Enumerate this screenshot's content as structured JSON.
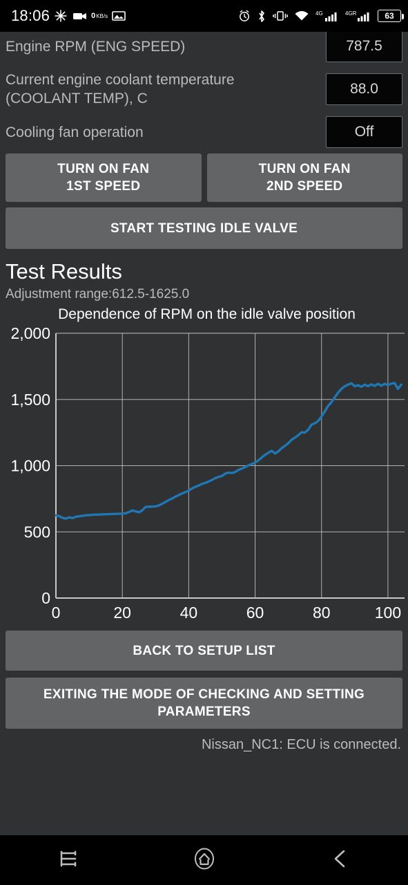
{
  "status_bar": {
    "clock": "18:06",
    "net_speed_value": "0",
    "net_speed_unit": "KB/s",
    "battery": "63",
    "network_1": "4G",
    "network_2": "4GR",
    "icons": [
      "burst-icon",
      "camera-icon",
      "image-icon",
      "alarm-icon",
      "bluetooth-icon",
      "vibrate-icon",
      "wifi-icon",
      "signal-icon",
      "signal-icon",
      "battery-icon"
    ]
  },
  "params": [
    {
      "label": "Engine RPM (ENG SPEED)",
      "value": "787.5"
    },
    {
      "label": "Current engine coolant temperature (COOLANT TEMP), C",
      "value": "88.0"
    },
    {
      "label": "Cooling fan operation",
      "value": "Off"
    }
  ],
  "buttons": {
    "fan1_line1": "TURN ON FAN",
    "fan1_line2": "1ST SPEED",
    "fan2_line1": "TURN ON FAN",
    "fan2_line2": "2ND SPEED",
    "start_test": "START TESTING IDLE VALVE",
    "back_to_setup": "BACK TO SETUP LIST",
    "exit_line1": "EXITING THE MODE OF CHECKING AND SETTING",
    "exit_line2": "PARAMETERS"
  },
  "results": {
    "heading": "Test Results",
    "adjustment_range": "Adjustment range:612.5-1625.0"
  },
  "status_line": "Nissan_NC1: ECU is connected.",
  "nav": {
    "recents": "recents-icon",
    "home": "home-icon",
    "back": "back-icon"
  },
  "colors": {
    "line": "#1f77b4",
    "grid": "#c8c8c8",
    "panel": "#303133",
    "button": "#636466",
    "text": "#b9bbbd"
  },
  "chart_data": {
    "type": "line",
    "title": "Dependence of RPM on the idle valve position",
    "xlabel": "",
    "ylabel": "",
    "xlim": [
      0,
      105
    ],
    "ylim": [
      0,
      2000
    ],
    "xticks": [
      0,
      20,
      40,
      60,
      80,
      100
    ],
    "yticks": [
      0,
      500,
      1000,
      1500,
      2000
    ],
    "ytick_labels": [
      "0",
      "500",
      "1,000",
      "1,500",
      "2,000"
    ],
    "xtick_labels": [
      "0",
      "20",
      "40",
      "60",
      "80",
      "100"
    ],
    "grid": true,
    "legend": "none",
    "series": [
      {
        "name": "RPM",
        "x": [
          0,
          1,
          2,
          3,
          4,
          5,
          6,
          7,
          8,
          9,
          10,
          11,
          12,
          13,
          14,
          15,
          16,
          17,
          18,
          19,
          20,
          21,
          22,
          23,
          24,
          25,
          26,
          27,
          28,
          29,
          30,
          31,
          32,
          33,
          34,
          35,
          36,
          37,
          38,
          39,
          40,
          41,
          42,
          43,
          44,
          45,
          46,
          47,
          48,
          49,
          50,
          51,
          52,
          53,
          54,
          55,
          56,
          57,
          58,
          59,
          60,
          61,
          62,
          63,
          64,
          65,
          66,
          67,
          68,
          69,
          70,
          71,
          72,
          73,
          74,
          75,
          76,
          77,
          78,
          79,
          80,
          81,
          82,
          83,
          84,
          85,
          86,
          87,
          88,
          89,
          90,
          91,
          92,
          93,
          94,
          95,
          96,
          97,
          98,
          99,
          100,
          101,
          102,
          103,
          104
        ],
        "y": [
          625,
          618,
          606,
          600,
          610,
          604,
          614,
          618,
          621,
          625,
          627,
          628,
          630,
          630,
          632,
          633,
          634,
          635,
          636,
          636,
          638,
          640,
          650,
          662,
          655,
          648,
          662,
          688,
          690,
          691,
          692,
          700,
          712,
          726,
          740,
          752,
          766,
          778,
          790,
          800,
          812,
          828,
          840,
          850,
          862,
          870,
          880,
          892,
          906,
          915,
          922,
          940,
          948,
          944,
          952,
          968,
          978,
          990,
          1002,
          1012,
          1024,
          1040,
          1062,
          1082,
          1098,
          1112,
          1092,
          1108,
          1132,
          1150,
          1170,
          1196,
          1212,
          1230,
          1252,
          1250,
          1272,
          1310,
          1320,
          1338,
          1372,
          1410,
          1452,
          1480,
          1516,
          1552,
          1580,
          1600,
          1612,
          1622,
          1600,
          1608,
          1596,
          1612,
          1600,
          1614,
          1602,
          1618,
          1604,
          1618,
          1608,
          1620,
          1624,
          1580,
          1612,
          1592,
          1626,
          1600,
          1614
        ]
      }
    ]
  }
}
